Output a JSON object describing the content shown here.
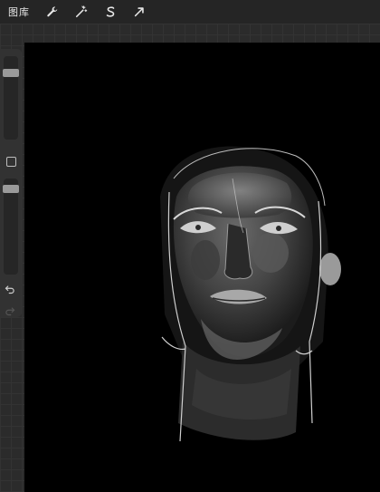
{
  "toolbar": {
    "gallery_label": "图库",
    "tools": [
      {
        "name": "actions-wrench-icon"
      },
      {
        "name": "adjustments-wand-icon"
      },
      {
        "name": "selection-s-icon"
      },
      {
        "name": "transform-arrow-icon"
      }
    ]
  },
  "sidebar": {
    "brush_size_level": 0.2,
    "opacity_level": 0.25
  },
  "colors": {
    "toolbar_bg": "#252525",
    "canvas_bg": "#000000",
    "sidebar_bg": "#323232"
  }
}
